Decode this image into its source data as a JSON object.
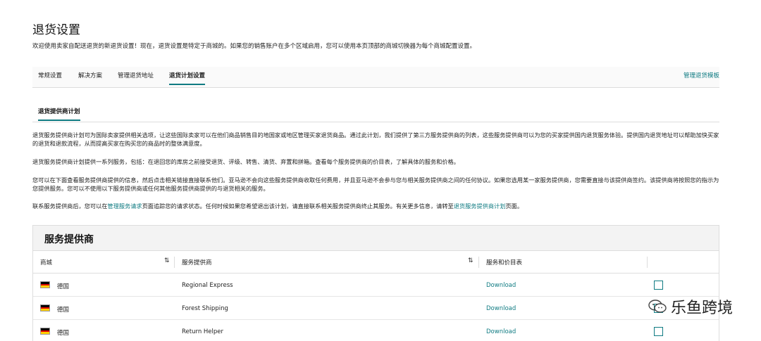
{
  "page": {
    "title": "退货设置",
    "intro": "欢迎使用卖家自配送退货的新退货设置！现在，退货设置是特定于商城的。如果您的销售账户在多个区域启用，您可以使用本页顶部的商城切换器为每个商城配置设置。"
  },
  "tabs": [
    {
      "label": "常规设置"
    },
    {
      "label": "解决方案"
    },
    {
      "label": "管理退货地址"
    },
    {
      "label": "退货计划设置"
    }
  ],
  "manage_link": "管理退货模板",
  "subtab": "退货提供商计划",
  "paragraphs": {
    "p1": "退货服务提供商计划可为国际卖家提供相关选项，让这些国际卖家可以在他们商品销售目的地国家或地区管理买家退货商品。通过此计划，我们提供了第三方服务提供商的列表，这些服务提供商可以为您的买家提供国内退货服务体验。提供国内退货地址可以帮助加快买家的退货和退款流程，从而提高买家在购买您的商品时的整体满意度。",
    "p2": "退货服务提供商计划提供一系列服务，包括：在退回您的库房之前接受退货、评级、转售、清货、弃置和拼箱。查看每个服务提供商的价目表，了解具体的服务和价格。",
    "p3": "您可以在下面查看服务提供商提供的信息，然后点击相关链接直接联系他们。亚马逊不会向这些服务提供商收取任何费用，并且亚马逊不会参与您与相关服务提供商之间的任何协议。如果您选用某一家服务提供商，您需要直接与该提供商签约。该提供商将按照您的指示为您提供服务。您可以不使用以下服务提供商或任何其他服务提供商提供的与退货相关的服务。",
    "p4_a": "联系服务提供商后，您可以在",
    "p4_link1": "管理服务请求",
    "p4_b": "页面追踪您的请求状态。任何时候如果您希望退出该计划，请直接联系相关服务提供商终止其服务。有关更多信息，请转至",
    "p4_link2": "退货服务提供商计划",
    "p4_c": "页面。"
  },
  "panel": {
    "title": "服务提供商",
    "columns": [
      "商城",
      "服务提供商",
      "服务和价目表"
    ],
    "rows": [
      {
        "country": "德国",
        "provider": "Regional Express",
        "link": "Download"
      },
      {
        "country": "德国",
        "provider": "Forest Shipping",
        "link": "Download"
      },
      {
        "country": "德国",
        "provider": "Return Helper",
        "link": "Download"
      }
    ]
  },
  "watermark": "乐鱼跨境",
  "colors": {
    "accent": "#0f7b82",
    "flag": [
      "#000000",
      "#dd0000",
      "#ffce00"
    ]
  }
}
